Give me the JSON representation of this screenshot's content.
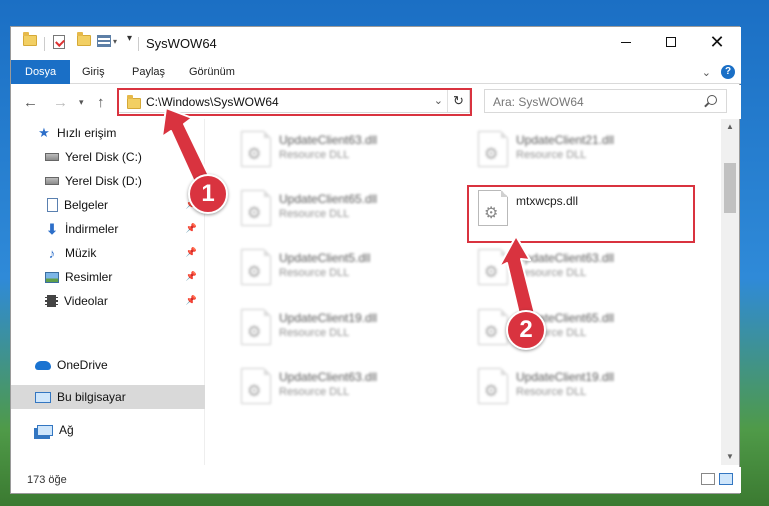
{
  "window": {
    "title": "SysWOW64"
  },
  "ribbon": {
    "tabs": [
      "Dosya",
      "Giriş",
      "Paylaş",
      "Görünüm"
    ]
  },
  "nav": {
    "address": "C:\\Windows\\SysWOW64",
    "search_placeholder": "Ara: SysWOW64"
  },
  "sidebar": {
    "items": [
      {
        "label": "Hızlı erişim",
        "icon": "star-icon"
      },
      {
        "label": "Yerel Disk (C:)",
        "icon": "disk-icon"
      },
      {
        "label": "Yerel Disk (D:)",
        "icon": "disk-icon"
      },
      {
        "label": "Belgeler",
        "icon": "document-icon",
        "pinned": true
      },
      {
        "label": "İndirmeler",
        "icon": "download-icon",
        "pinned": true
      },
      {
        "label": "Müzik",
        "icon": "music-icon",
        "pinned": true
      },
      {
        "label": "Resimler",
        "icon": "pictures-icon",
        "pinned": true
      },
      {
        "label": "Videolar",
        "icon": "video-icon",
        "pinned": true
      },
      {
        "label": "OneDrive",
        "icon": "onedrive-icon"
      },
      {
        "label": "Bu bilgisayar",
        "icon": "computer-icon",
        "selected": true
      },
      {
        "label": "Ağ",
        "icon": "network-icon"
      }
    ]
  },
  "files": [
    {
      "name": "UpdateClient63.dll",
      "type": "Resource DLL",
      "blurred": true
    },
    {
      "name": "UpdateClient21.dll",
      "type": "Resource DLL",
      "blurred": true
    },
    {
      "name": "UpdateClient65.dll",
      "type": "Resource DLL",
      "blurred": true
    },
    {
      "name": "mtxwcps.dll",
      "type": "",
      "blurred": false,
      "highlighted": true
    },
    {
      "name": "UpdateClient5.dll",
      "type": "Resource DLL",
      "blurred": true
    },
    {
      "name": "UpdateClient63.dll",
      "type": "Resource DLL",
      "blurred": true
    },
    {
      "name": "UpdateClient19.dll",
      "type": "Resource DLL",
      "blurred": true
    },
    {
      "name": "UpdateClient65.dll",
      "type": "Resource DLL",
      "blurred": true
    },
    {
      "name": "UpdateClient63.dll",
      "type": "Resource DLL",
      "blurred": true
    },
    {
      "name": "UpdateClient19.dll",
      "type": "Resource DLL",
      "blurred": true
    }
  ],
  "status": {
    "count": "173 öğe"
  },
  "annotations": {
    "step1": "1",
    "step2": "2",
    "color": "#d9333f"
  }
}
